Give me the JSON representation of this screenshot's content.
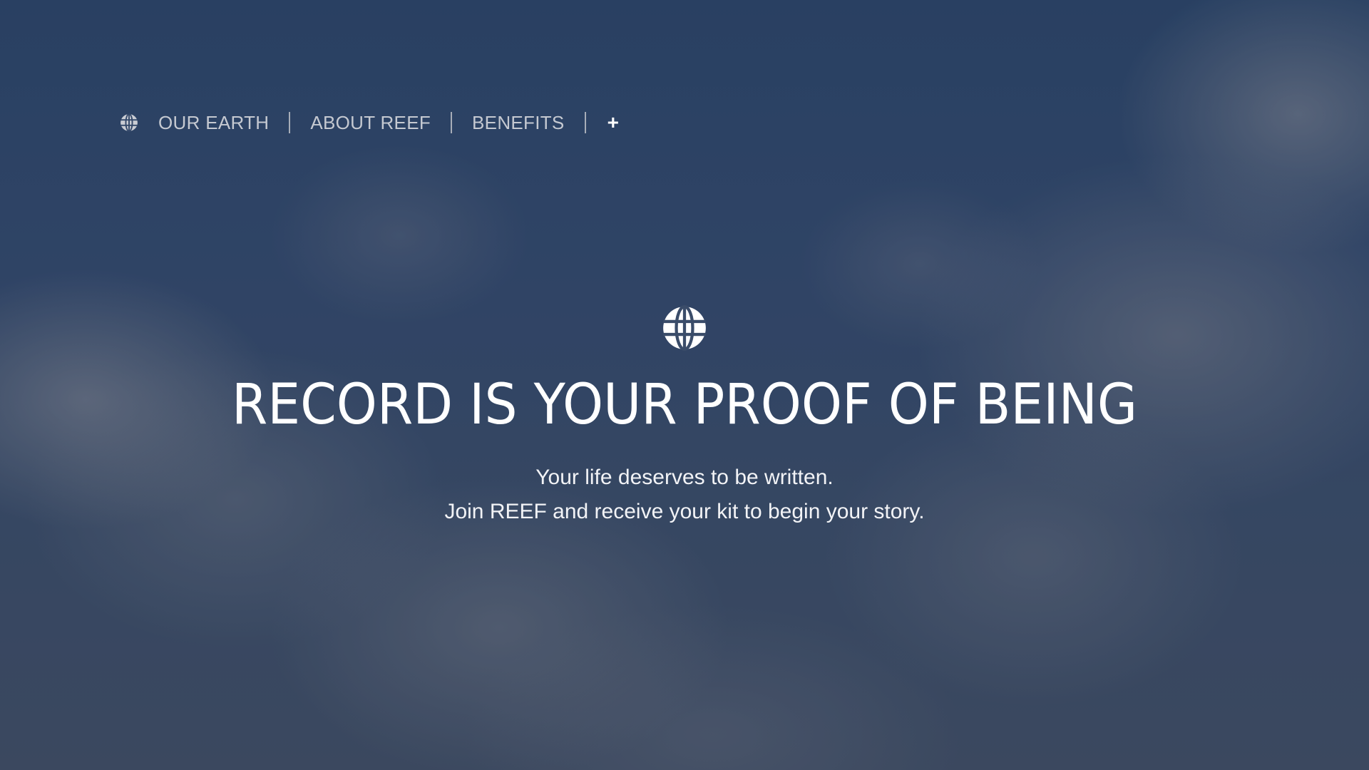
{
  "nav": {
    "icon": "globe-icon",
    "links": [
      "OUR EARTH",
      "ABOUT REEF",
      "BENEFITS"
    ],
    "more_label": "+"
  },
  "hero": {
    "icon": "globe-icon",
    "title": "RECORD IS YOUR PROOF OF BEING",
    "subtitle_line1": "Your life deserves to be written.",
    "subtitle_line2": "Join REEF and receive your kit to begin your story."
  },
  "colors": {
    "background": "#34496a",
    "nav_text": "#c5c9d1",
    "hero_text": "#ffffff"
  }
}
